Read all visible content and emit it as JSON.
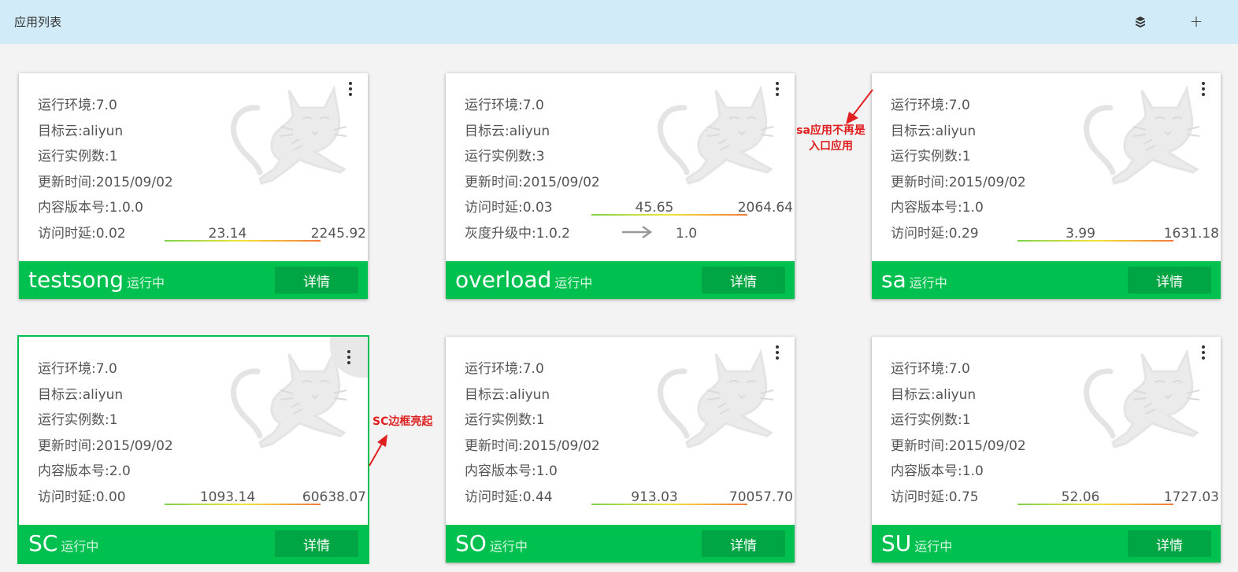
{
  "header": {
    "title": "应用列表",
    "add_label": "+",
    "icons": [
      "package-icon",
      "add-icon"
    ]
  },
  "labels": {
    "env": "运行环境:",
    "cloud": "目标云:",
    "instances": "运行实例数:",
    "updated": "更新时间:",
    "version": "内容版本号:",
    "latency": "访问时延:",
    "upgrading": "灰度升级中:",
    "detail": "详情"
  },
  "colors": {
    "accent_green": "#00c050",
    "button_green": "#00a644",
    "header_bg": "#d1ebf8",
    "annotation_red": "#e02020"
  },
  "apps": [
    {
      "name": "testsong",
      "status": "运行中",
      "env": "运行环境:7.0",
      "cloud": "目标云:aliyun",
      "instances": "运行实例数:1",
      "updated": "更新时间:2015/09/02",
      "version": "内容版本号:1.0.0",
      "latency": "访问时延:0.02",
      "gauge_mid": "23.14",
      "gauge_max": "2245.92",
      "detail": "详情"
    },
    {
      "name": "overload",
      "status": "运行中",
      "env": "运行环境:7.0",
      "cloud": "目标云:aliyun",
      "instances": "运行实例数:3",
      "updated": "更新时间:2015/09/02",
      "latency": "访问时延:0.03",
      "gauge_mid": "45.65",
      "gauge_max": "2064.64",
      "upgrade_from": "灰度升级中:1.0.2",
      "upgrade_to": "1.0",
      "detail": "详情"
    },
    {
      "name": "sa",
      "status": "运行中",
      "env": "运行环境:7.0",
      "cloud": "目标云:aliyun",
      "instances": "运行实例数:1",
      "updated": "更新时间:2015/09/02",
      "version": "内容版本号:1.0",
      "latency": "访问时延:0.29",
      "gauge_mid": "3.99",
      "gauge_max": "1631.18",
      "detail": "详情"
    },
    {
      "name": "SC",
      "status": "运行中",
      "env": "运行环境:7.0",
      "cloud": "目标云:aliyun",
      "instances": "运行实例数:1",
      "updated": "更新时间:2015/09/02",
      "version": "内容版本号:2.0",
      "latency": "访问时延:0.00",
      "gauge_mid": "1093.14",
      "gauge_max": "60638.07",
      "detail": "详情"
    },
    {
      "name": "SO",
      "status": "运行中",
      "env": "运行环境:7.0",
      "cloud": "目标云:aliyun",
      "instances": "运行实例数:1",
      "updated": "更新时间:2015/09/02",
      "version": "内容版本号:1.0",
      "latency": "访问时延:0.44",
      "gauge_mid": "913.03",
      "gauge_max": "70057.70",
      "detail": "详情"
    },
    {
      "name": "SU",
      "status": "运行中",
      "env": "运行环境:7.0",
      "cloud": "目标云:aliyun",
      "instances": "运行实例数:1",
      "updated": "更新时间:2015/09/02",
      "version": "内容版本号:1.0",
      "latency": "访问时延:0.75",
      "gauge_mid": "52.06",
      "gauge_max": "1727.03",
      "detail": "详情"
    }
  ],
  "annotations": {
    "sa_line1": "sa应用不再是",
    "sa_line2": "入口应用",
    "sc": "SC边框亮起"
  }
}
